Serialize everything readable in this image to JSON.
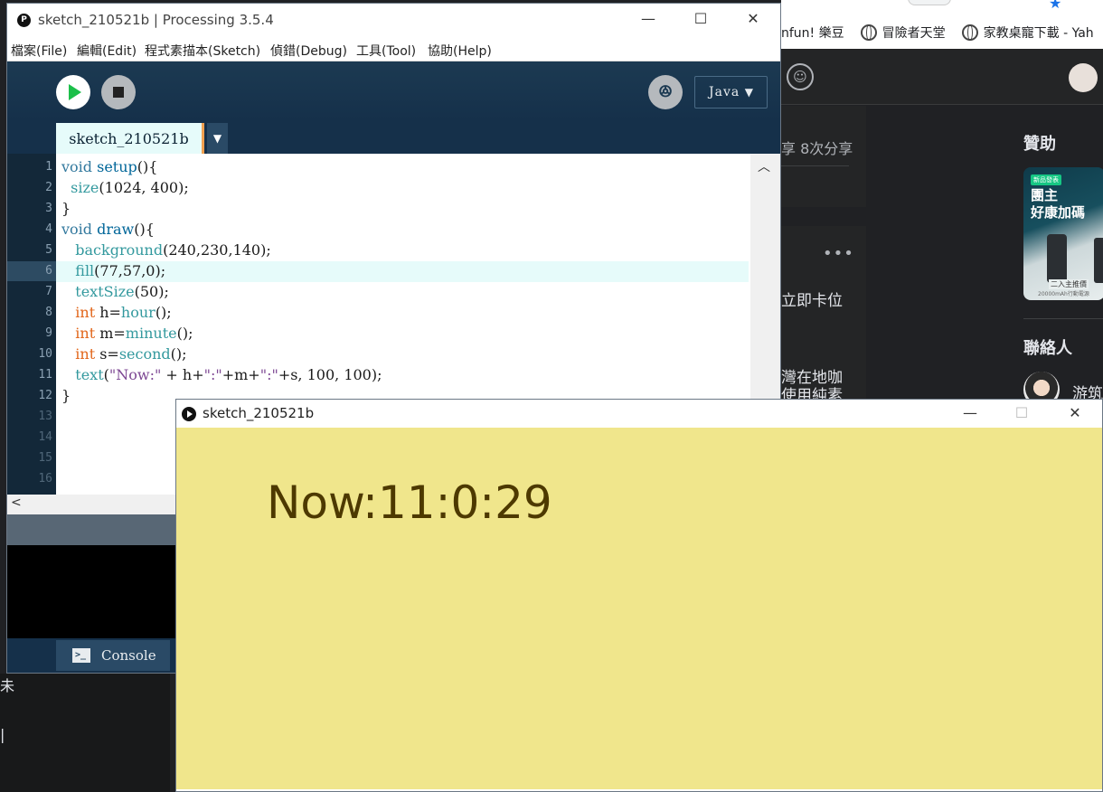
{
  "background_browser": {
    "bookmarks": [
      "nfun! 樂豆",
      "冒險者天堂",
      "家教桌寵下載 - Yah"
    ],
    "post1_share_text": "享 8次分享",
    "post2_more": "•••",
    "post2_text1": "立即卡位",
    "post2_text2": "灣在地咖",
    "post2_text3": "使用純素",
    "sponsor_title": "贊助",
    "ad_tag": "新品發表",
    "ad_headline_1": "團主",
    "ad_headline_2": "好康加碼",
    "ad_subtext": "二入主推價",
    "ad_subtext2": "20000mAh行動電源",
    "contacts_title": "聯絡人",
    "contact_name": "游筑",
    "left_fragment_1": "未",
    "left_fragment_2": "|"
  },
  "ide": {
    "app_icon_glyph": "P",
    "title": "sketch_210521b | Processing 3.5.4",
    "window_controls": {
      "minimize": "—",
      "maximize": "☐",
      "close": "✕"
    },
    "menu": [
      "檔案(File)",
      "編輯(Edit)",
      "程式素描本(Sketch)",
      "偵錯(Debug)",
      "工具(Tool)",
      "協助(Help)"
    ],
    "debug_glyph": "ꔮ",
    "mode": "Java",
    "mode_caret": "▼",
    "tab_name": "sketch_210521b",
    "tab_menu_glyph": "▼",
    "line_numbers": [
      "1",
      "2",
      "3",
      "4",
      "5",
      "6",
      "7",
      "8",
      "9",
      "10",
      "11",
      "12",
      "13",
      "14",
      "15",
      "16"
    ],
    "code": {
      "l1_kw": "void",
      "l1_fn": "setup",
      "l1_rest": "(){",
      "l2_bi": "size",
      "l2_rest": "(1024, 400);",
      "l3": "}",
      "l4_kw": "void",
      "l4_fn": "draw",
      "l4_rest": "(){",
      "l5_bi": "background",
      "l5_rest": "(240,230,140);",
      "l6_bi": "fill",
      "l6_rest": "(77,57,0);",
      "l7_bi": "textSize",
      "l7_rest": "(50);",
      "l8_ty": "int",
      "l8_a": " h=",
      "l8_bi": "hour",
      "l8_rest": "();",
      "l9_ty": "int",
      "l9_a": " m=",
      "l9_bi": "minute",
      "l9_rest": "();",
      "l10_ty": "int",
      "l10_a": " s=",
      "l10_bi": "second",
      "l10_rest": "();",
      "l11_bi": "text",
      "l11_p1": "(",
      "l11_s1": "\"Now:\"",
      "l11_p2": " + h+",
      "l11_s2": "\":\"",
      "l11_p3": "+m+",
      "l11_s3": "\":\"",
      "l11_p4": "+s, 100, 100);",
      "l12": "}"
    },
    "scroll_up_glyph": "︿",
    "scroll_left_glyph": "<",
    "console_icon_glyph": ">_",
    "console_label": "Console"
  },
  "sketch": {
    "title": "sketch_210521b",
    "window_controls": {
      "minimize": "—",
      "maximize": "☐",
      "close": "✕"
    },
    "canvas_color": "#f0e68c",
    "text_color": "#4d3900",
    "clock_text": "Now:11:0:29"
  }
}
